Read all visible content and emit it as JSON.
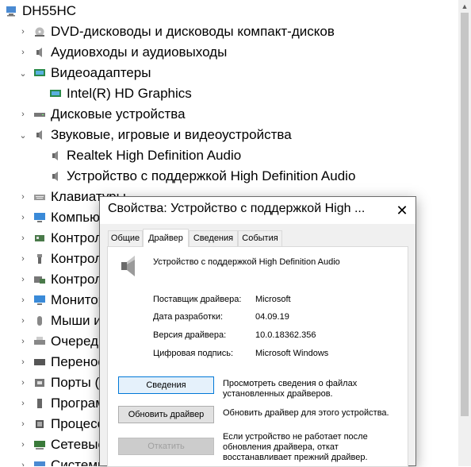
{
  "tree": {
    "root": "DH55HC",
    "items": [
      {
        "label": "DVD-дисководы и дисководы компакт-дисков",
        "expanded": false
      },
      {
        "label": "Аудиовходы и аудиовыходы",
        "expanded": false
      },
      {
        "label": "Видеоадаптеры",
        "expanded": true
      },
      {
        "label": "Intel(R) HD Graphics",
        "child": true
      },
      {
        "label": "Дисковые устройства",
        "expanded": false
      },
      {
        "label": "Звуковые, игровые и видеоустройства",
        "expanded": true
      },
      {
        "label": "Realtek High Definition Audio",
        "child": true
      },
      {
        "label": "Устройство с поддержкой High Definition Audio",
        "child": true
      },
      {
        "label": "Клавиатуры",
        "expanded": false
      },
      {
        "label": "Компьютер",
        "expanded": false
      },
      {
        "label": "Контроллеры",
        "expanded": false
      },
      {
        "label": "Контроллеры",
        "expanded": false
      },
      {
        "label": "Контроллеры",
        "expanded": false
      },
      {
        "label": "Мониторы",
        "expanded": false
      },
      {
        "label": "Мыши и",
        "expanded": false
      },
      {
        "label": "Очереди",
        "expanded": false
      },
      {
        "label": "Переносные",
        "expanded": false
      },
      {
        "label": "Порты (",
        "expanded": false
      },
      {
        "label": "Программные",
        "expanded": false
      },
      {
        "label": "Процессоры",
        "expanded": false
      },
      {
        "label": "Сетевые",
        "expanded": false
      },
      {
        "label": "Системные",
        "expanded": false
      }
    ]
  },
  "dialog": {
    "title": "Свойства: Устройство с поддержкой High ...",
    "close": "✕",
    "tabs": [
      "Общие",
      "Драйвер",
      "Сведения",
      "События"
    ],
    "active_tab": "Драйвер",
    "device_name": "Устройство с поддержкой High Definition Audio",
    "fields": [
      {
        "label": "Поставщик драйвера:",
        "value": "Microsoft"
      },
      {
        "label": "Дата разработки:",
        "value": "04.09.19"
      },
      {
        "label": "Версия драйвера:",
        "value": "10.0.18362.356"
      },
      {
        "label": "Цифровая подпись:",
        "value": "Microsoft Windows"
      }
    ],
    "buttons": [
      {
        "label": "Сведения",
        "desc": "Просмотреть сведения о файлах установленных драйверов."
      },
      {
        "label": "Обновить драйвер",
        "desc": "Обновить драйвер для этого устройства."
      },
      {
        "label": "Откатить",
        "desc": "Если устройство не работает после обновления драйвера, откат восстанавливает прежний драйвер."
      }
    ]
  }
}
